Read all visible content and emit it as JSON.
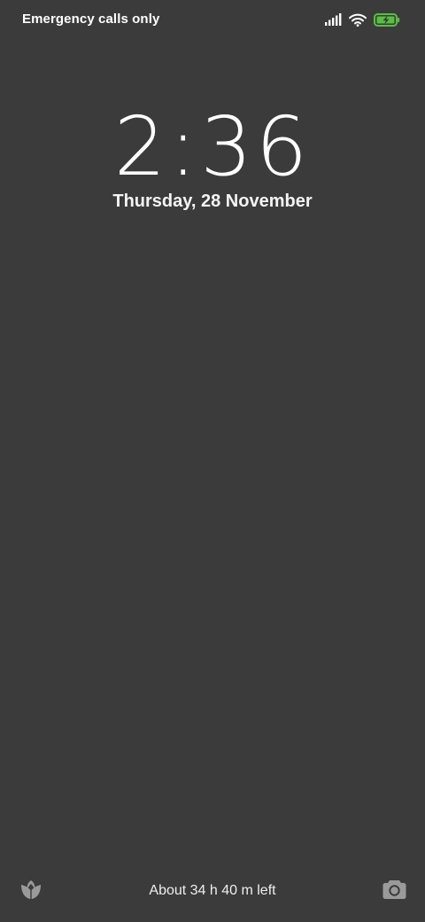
{
  "status_bar": {
    "carrier_text": "Emergency calls only",
    "icons": [
      "signal-bars-icon",
      "wifi-icon",
      "battery-charging-icon"
    ],
    "battery_color": "#56c13f"
  },
  "lock_screen": {
    "time": "2:36",
    "date": "Thursday, 28 November"
  },
  "bottom_bar": {
    "left_shortcut_icon": "leaf-icon",
    "battery_estimate": "About 34 h 40 m left",
    "right_shortcut_icon": "camera-icon"
  },
  "colors": {
    "background": "#3b3b3b",
    "text": "#ffffff",
    "shortcut_icon": "#9a9a9a"
  }
}
